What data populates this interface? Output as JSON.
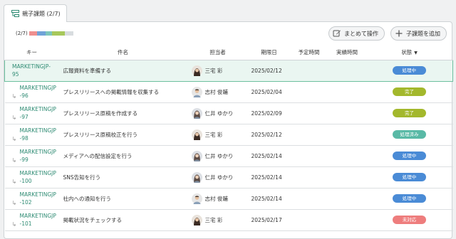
{
  "tab": {
    "label": "親子課題 (2/7)"
  },
  "progress": {
    "label": "(2/7)",
    "segments": [
      {
        "color": "#ee8f8f",
        "fraction": 0.17
      },
      {
        "color": "#70a3d8",
        "fraction": 0.2
      },
      {
        "color": "#7dc6bb",
        "fraction": 0.14
      },
      {
        "color": "#a7c85b",
        "fraction": 0.29
      },
      {
        "color": "#d8dcdf",
        "fraction": 0.2
      }
    ]
  },
  "toolbar": {
    "batch_label": "まとめて操作",
    "add_label": "子課題を追加"
  },
  "columns": {
    "key": "キー",
    "subject": "件名",
    "assignee": "担当者",
    "due": "期限日",
    "planned": "予定時間",
    "actual": "実績時間",
    "status": "状態"
  },
  "rows": [
    {
      "key1": "MARKETINGJP-",
      "key2": "95",
      "child": false,
      "subject": "広報資料を準備する",
      "assignee": "三宅 彩",
      "avatar": "woman-dark",
      "due": "2025/02/12",
      "status": "処理中",
      "status_color": "#4a8bd6",
      "highlight": true
    },
    {
      "key1": "MARKETINGJP",
      "key2": "-96",
      "child": true,
      "subject": "プレスリリースへの掲載情報を収集する",
      "assignee": "志村 俊輔",
      "avatar": "man",
      "due": "2025/02/04",
      "status": "完了",
      "status_color": "#a3b82c",
      "highlight": false
    },
    {
      "key1": "MARKETINGJP",
      "key2": "-97",
      "child": true,
      "subject": "プレスリリース原稿を作成する",
      "assignee": "仁井 ゆかり",
      "avatar": "woman-grey",
      "due": "2025/02/09",
      "status": "完了",
      "status_color": "#a3b82c",
      "highlight": false
    },
    {
      "key1": "MARKETINGJP",
      "key2": "-98",
      "child": true,
      "subject": "プレスリリース原稿校正を行う",
      "assignee": "三宅 彩",
      "avatar": "woman-dark",
      "due": "2025/02/12",
      "status": "処理済み",
      "status_color": "#59b9a6",
      "highlight": false
    },
    {
      "key1": "MARKETINGJP",
      "key2": "-99",
      "child": true,
      "subject": "メディアへの配信設定を行う",
      "assignee": "仁井 ゆかり",
      "avatar": "woman-grey",
      "due": "2025/02/14",
      "status": "処理中",
      "status_color": "#4a8bd6",
      "highlight": false
    },
    {
      "key1": "MARKETINGJP",
      "key2": "-100",
      "child": true,
      "subject": "SNS告知を行う",
      "assignee": "仁井 ゆかり",
      "avatar": "woman-grey",
      "due": "2025/02/14",
      "status": "処理中",
      "status_color": "#4a8bd6",
      "highlight": false
    },
    {
      "key1": "MARKETINGJP",
      "key2": "-102",
      "child": true,
      "subject": "社内への通知を行う",
      "assignee": "志村 俊輔",
      "avatar": "man",
      "due": "2025/02/14",
      "status": "処理中",
      "status_color": "#4a8bd6",
      "highlight": false
    },
    {
      "key1": "MARKETINGJP",
      "key2": "-101",
      "child": true,
      "subject": "掲載状況をチェックする",
      "assignee": "三宅 彩",
      "avatar": "woman-dark",
      "due": "2025/02/17",
      "status": "未対応",
      "status_color": "#ee7d7d",
      "highlight": false
    }
  ]
}
